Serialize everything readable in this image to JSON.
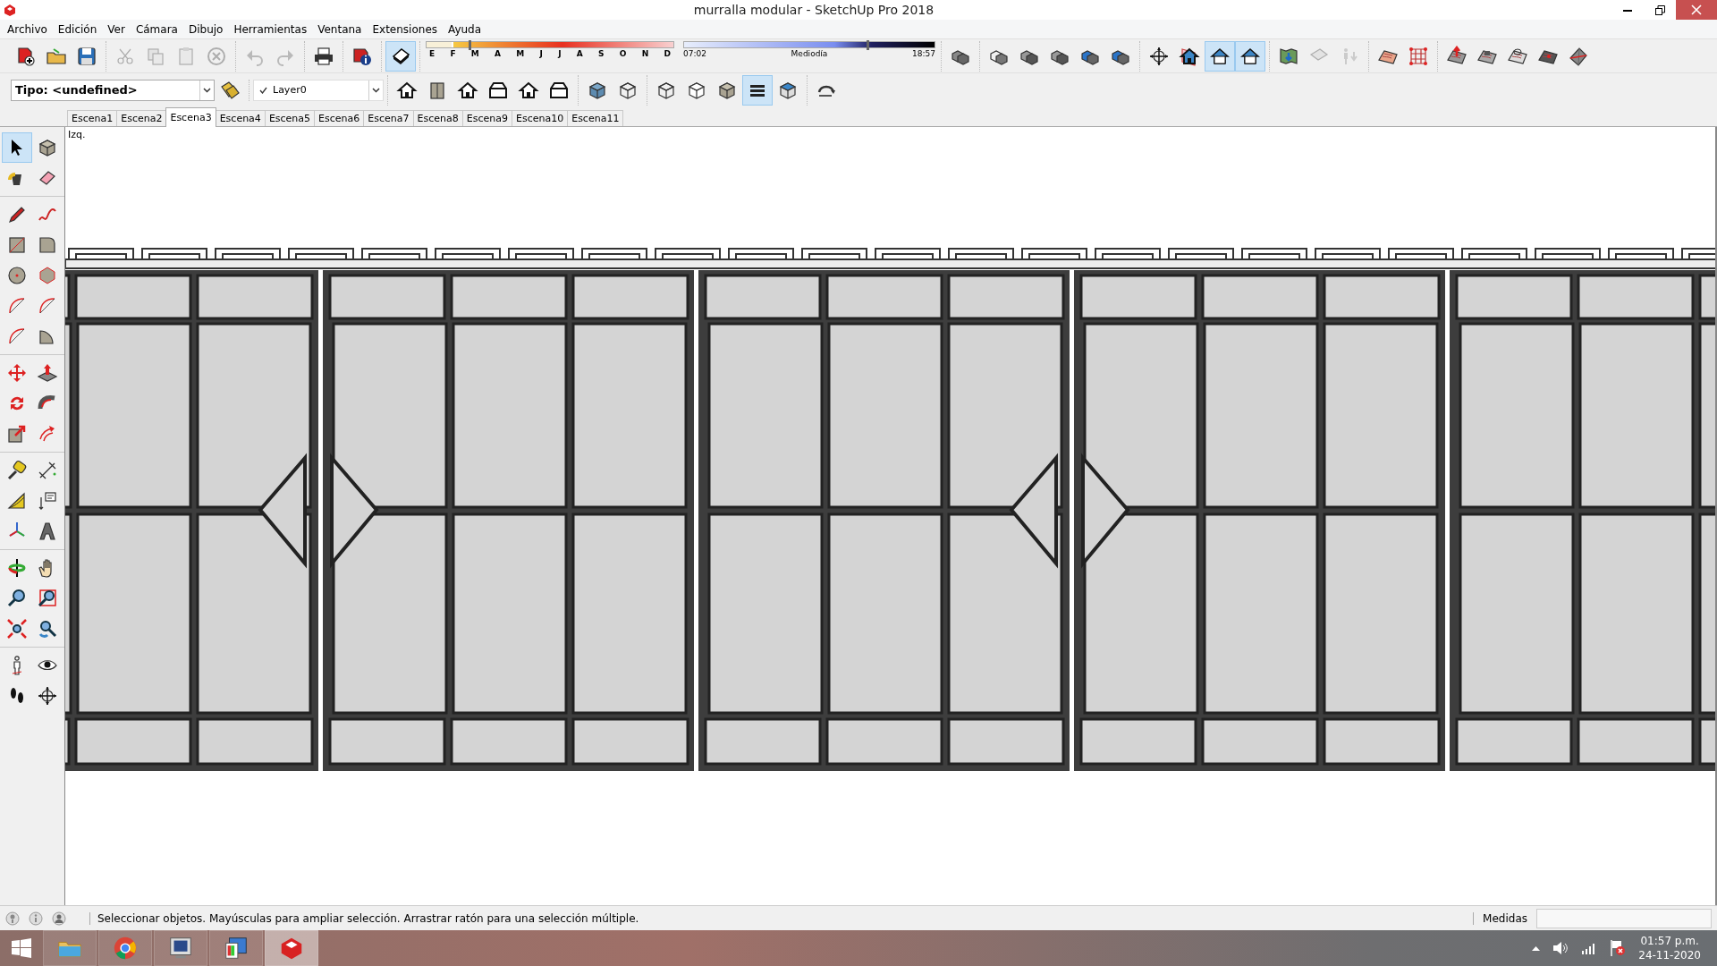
{
  "window": {
    "title": "murralla modular - SketchUp Pro 2018"
  },
  "menu": [
    "Archivo",
    "Edición",
    "Ver",
    "Cámara",
    "Dibujo",
    "Herramientas",
    "Ventana",
    "Extensiones",
    "Ayuda"
  ],
  "main_toolbar": {
    "items": [
      {
        "selected": false,
        "disabled": false
      },
      {
        "selected": false,
        "disabled": false
      },
      {
        "selected": false,
        "disabled": false
      },
      {
        "selected": false,
        "disabled": true
      },
      {
        "selected": false,
        "disabled": true
      },
      {
        "selected": false,
        "disabled": true
      },
      {
        "selected": false,
        "disabled": true
      },
      {
        "selected": false,
        "disabled": true
      },
      {
        "selected": false,
        "disabled": true
      },
      {
        "selected": false,
        "disabled": false
      },
      {
        "selected": false,
        "disabled": false
      },
      {
        "selected": true,
        "disabled": false
      },
      {
        "selected": false,
        "disabled": false
      },
      {
        "selected": false,
        "disabled": false
      },
      {
        "selected": false,
        "disabled": false
      },
      {
        "selected": false,
        "disabled": false
      },
      {
        "selected": false,
        "disabled": false
      },
      {
        "selected": false,
        "disabled": false
      },
      {
        "selected": false,
        "disabled": false
      },
      {
        "selected": false,
        "disabled": false
      },
      {
        "selected": true,
        "disabled": false
      },
      {
        "selected": true,
        "disabled": false
      },
      {
        "selected": false,
        "disabled": false
      },
      {
        "selected": false,
        "disabled": true
      },
      {
        "selected": false,
        "disabled": true
      },
      {
        "selected": false,
        "disabled": false
      },
      {
        "selected": false,
        "disabled": false
      },
      {
        "selected": false,
        "disabled": false
      },
      {
        "selected": false,
        "disabled": false
      },
      {
        "selected": false,
        "disabled": false
      },
      {
        "selected": false,
        "disabled": false
      },
      {
        "selected": false,
        "disabled": false
      }
    ]
  },
  "date_slider": {
    "labels": [
      "E",
      "F",
      "M",
      "A",
      "M",
      "J",
      "J",
      "A",
      "S",
      "O",
      "N",
      "D"
    ],
    "level": 0.17
  },
  "time_slider": {
    "start": "07:02",
    "middle": "Mediodía",
    "end": "18:57",
    "level": 0.73
  },
  "type_field": {
    "value": "Tipo: <undefined>"
  },
  "layer_field": {
    "value": "Layer0"
  },
  "view_toolbar": {
    "items": [
      {
        "selected": false
      },
      {
        "selected": false
      },
      {
        "selected": false
      },
      {
        "selected": false
      },
      {
        "selected": false
      },
      {
        "selected": false
      },
      {
        "selected": false
      },
      {
        "selected": false
      },
      {
        "selected": false
      },
      {
        "selected": false
      },
      {
        "selected": false
      },
      {
        "selected": true
      },
      {
        "selected": false
      },
      {
        "selected": false
      }
    ]
  },
  "scene_tabs": [
    {
      "label": "Escena1",
      "selected": false
    },
    {
      "label": "Escena2",
      "selected": false
    },
    {
      "label": "Escena3",
      "selected": true
    },
    {
      "label": "Escena4",
      "selected": false
    },
    {
      "label": "Escena5",
      "selected": false
    },
    {
      "label": "Escena6",
      "selected": false
    },
    {
      "label": "Escena7",
      "selected": false
    },
    {
      "label": "Escena8",
      "selected": false
    },
    {
      "label": "Escena9",
      "selected": false
    },
    {
      "label": "Escena10",
      "selected": false
    },
    {
      "label": "Escena11",
      "selected": false
    }
  ],
  "tool_palette": {
    "items": [
      {
        "selected": true
      },
      {
        "selected": false
      },
      {
        "selected": false
      },
      {
        "selected": false
      },
      {
        "selected": false
      },
      {
        "selected": false
      },
      {
        "selected": false
      },
      {
        "selected": false
      },
      {
        "selected": false
      },
      {
        "selected": false
      },
      {
        "selected": false
      },
      {
        "selected": false
      },
      {
        "selected": false
      },
      {
        "selected": false
      },
      {
        "selected": false
      },
      {
        "selected": false
      },
      {
        "selected": false
      },
      {
        "selected": false
      },
      {
        "selected": false
      },
      {
        "selected": false
      },
      {
        "selected": false
      },
      {
        "selected": false
      },
      {
        "selected": false
      },
      {
        "selected": false
      },
      {
        "selected": false
      },
      {
        "selected": false
      },
      {
        "selected": false
      },
      {
        "selected": false
      },
      {
        "selected": false
      },
      {
        "selected": false
      },
      {
        "selected": false
      },
      {
        "selected": false
      },
      {
        "selected": false
      },
      {
        "selected": false
      },
      {
        "selected": false
      },
      {
        "selected": false
      }
    ]
  },
  "viewport": {
    "view_label": "Izq."
  },
  "status_bar": {
    "message": "Seleccionar objetos. Mayúsculas para ampliar selección. Arrastrar ratón para una selección múltiple.",
    "measure_label": "Medidas"
  },
  "taskbar": {
    "apps": [
      {
        "selected": false
      },
      {
        "selected": false
      },
      {
        "selected": false
      },
      {
        "selected": false
      },
      {
        "selected": true
      }
    ],
    "time": "01:57 p.m.",
    "date": "24-11-2020"
  }
}
